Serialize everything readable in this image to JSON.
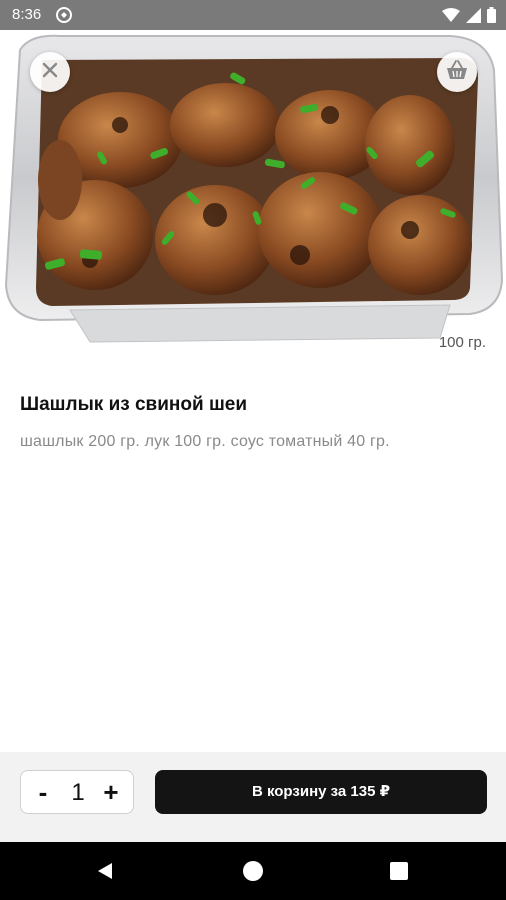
{
  "status_bar": {
    "time": "8:36"
  },
  "product": {
    "weight": "100 гр.",
    "title": "Шашлык из свиной шеи",
    "description": "шашлык 200 гр. лук 100 гр. соус томатный 40 гр."
  },
  "order": {
    "minus_label": "-",
    "quantity": "1",
    "plus_label": "+",
    "cart_button_label": "В корзину за 135 ₽"
  },
  "icons": {
    "close": "close-icon",
    "basket": "basket-icon",
    "back": "back-triangle-icon",
    "home": "home-circle-icon",
    "recents": "recents-square-icon"
  },
  "colors": {
    "status_bar": "#7a7a7a",
    "cart_button": "#141414",
    "action_bar": "#f2f2f2",
    "nav_bar": "#000000"
  }
}
